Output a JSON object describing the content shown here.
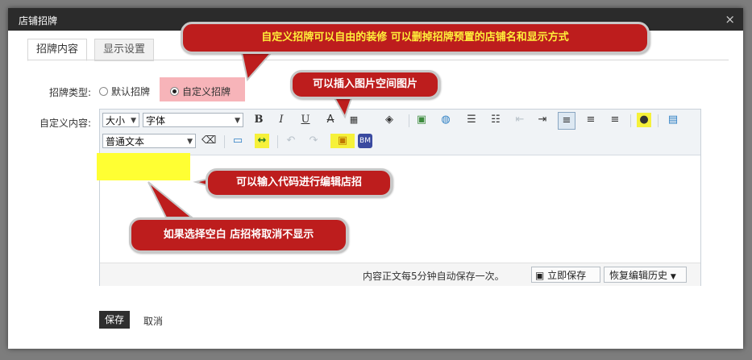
{
  "dialog": {
    "title": "店铺招牌",
    "close_glyph": "×",
    "tabs": [
      {
        "label": "招牌内容"
      },
      {
        "label": "显示设置"
      }
    ]
  },
  "form": {
    "type_label": "招牌类型:",
    "options": [
      {
        "label": "默认招牌",
        "selected": false
      },
      {
        "label": "自定义招牌",
        "selected": true
      }
    ],
    "content_label": "自定义内容:"
  },
  "editor": {
    "font_size_select": "大小",
    "font_family_select": "字体",
    "format_select": "普通文本",
    "status_text": "内容正文每5分钟自动保存一次。",
    "save_now_label": "立即保存",
    "history_label": "恢复编辑历史"
  },
  "callouts": {
    "top": "自定义招牌可以自由的装修 可以删掉招牌预置的店铺名和显示方式",
    "image": "可以插入图片空间图片",
    "code": "可以输入代码进行编辑店招",
    "blank": "如果选择空白 店招将取消不显示"
  },
  "footer": {
    "save_label": "保存",
    "cancel_label": "取消"
  },
  "colors": {
    "callout_bg": "#bd1d1d",
    "highlight_yellow": "#ffff33",
    "highlight_pink": "#f7b4b9",
    "title_bar": "#2b2b2b"
  }
}
